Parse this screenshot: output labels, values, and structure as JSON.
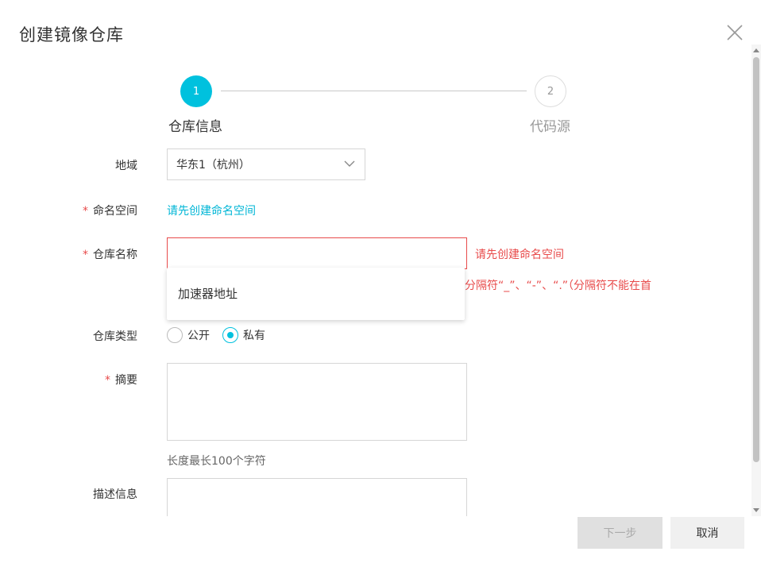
{
  "dialog": {
    "title": "创建镜像仓库",
    "close_icon": "close-icon"
  },
  "steps": [
    {
      "number": "1",
      "label": "仓库信息",
      "active": true
    },
    {
      "number": "2",
      "label": "代码源",
      "active": false
    }
  ],
  "form": {
    "region": {
      "label": "地域",
      "value": "华东1（杭州）"
    },
    "namespace": {
      "label": "命名空间",
      "required": "*",
      "link_text": "请先创建命名空间"
    },
    "repo_name": {
      "label": "仓库名称",
      "required": "*",
      "value": "",
      "error": "请先创建命名空间",
      "rule_text": "分隔符“_”、“-”、“.”（分隔符不能在首"
    },
    "autocomplete": {
      "items": [
        "加速器地址"
      ]
    },
    "repo_type": {
      "label": "仓库类型",
      "options": [
        {
          "label": "公开",
          "checked": false
        },
        {
          "label": "私有",
          "checked": true
        }
      ]
    },
    "summary": {
      "label": "摘要",
      "required": "*",
      "hint": "长度最长100个字符",
      "value": ""
    },
    "description": {
      "label": "描述信息",
      "value": ""
    }
  },
  "footer": {
    "next_label": "下一步",
    "cancel_label": "取消"
  },
  "colors": {
    "accent": "#00c1de",
    "error": "#e84b4b",
    "link": "#00b6d6"
  }
}
